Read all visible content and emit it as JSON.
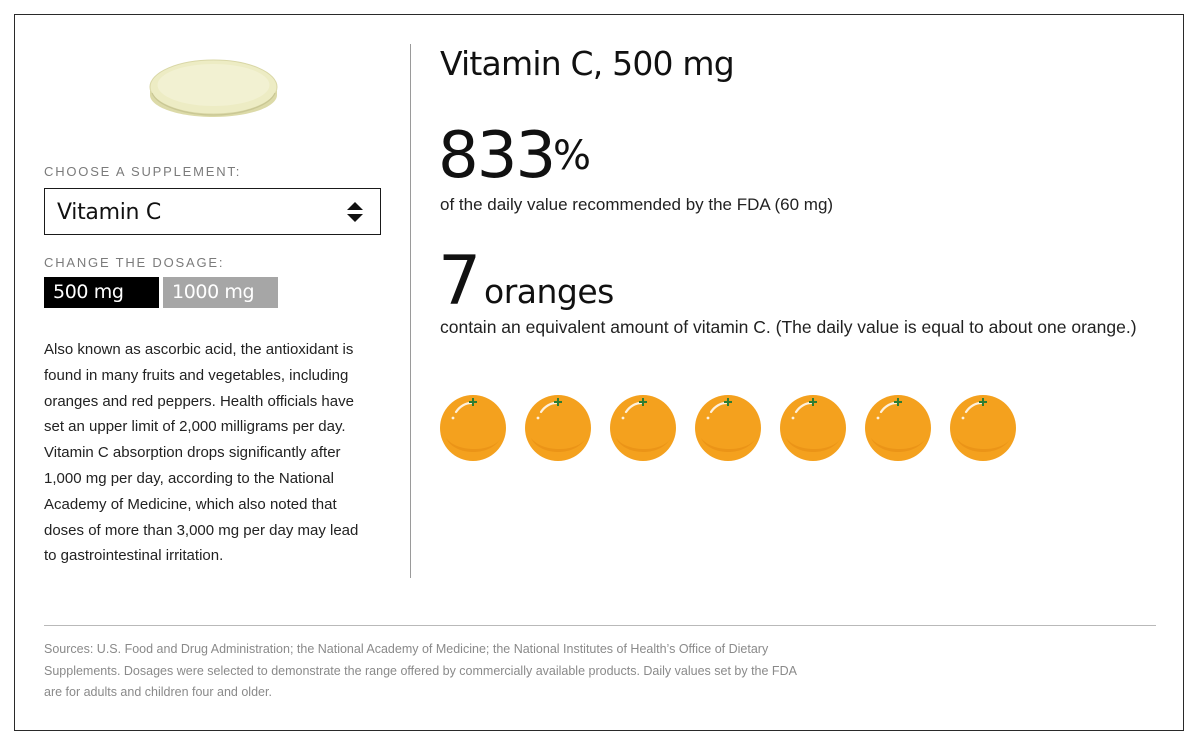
{
  "controls": {
    "supplement_label": "CHOOSE A SUPPLEMENT:",
    "supplement_selected": "Vitamin C",
    "dosage_label": "CHANGE THE DOSAGE:",
    "dosage_options": [
      "500 mg",
      "1000 mg"
    ],
    "dosage_selected": "500 mg"
  },
  "description": "Also known as ascorbic acid, the antioxidant is found in many fruits and vegetables, including oranges and red peppers. Health officials have set an upper limit of 2,000 milligrams per day. Vitamin C absorption drops significantly after 1,000 mg per day, according to the National Academy of Medicine, which also noted that doses of more than 3,000 mg per day may lead to gastrointestinal irritation.",
  "result": {
    "title": "Vitamin C, 500 mg",
    "percent_value": "833",
    "percent_sign": "%",
    "percent_caption": "of the daily value recommended by the FDA (60 mg)",
    "equivalent_count": "7",
    "equivalent_unit": "oranges",
    "equivalent_caption": "contain an equivalent amount of vitamin C. (The daily value is equal to about one orange.)",
    "orange_icon_count": 7
  },
  "icons": {
    "pill": "pill-icon",
    "select_arrows": "updown-arrow-icon",
    "fruit": "orange-icon"
  },
  "colors": {
    "orange_fill": "#F4A11E",
    "orange_stem": "#2E7D32",
    "pill_fill": "#EDECC4",
    "selected_dose_bg": "#000000",
    "unselected_dose_bg": "#A6A6A6"
  },
  "sources": "Sources: U.S. Food and Drug Administration; the National Academy of Medicine; the National Institutes of Health’s Office of Dietary Supplements. Dosages were selected to demonstrate the range offered by commercially available products. Daily values set by the FDA are for adults and children four and older."
}
